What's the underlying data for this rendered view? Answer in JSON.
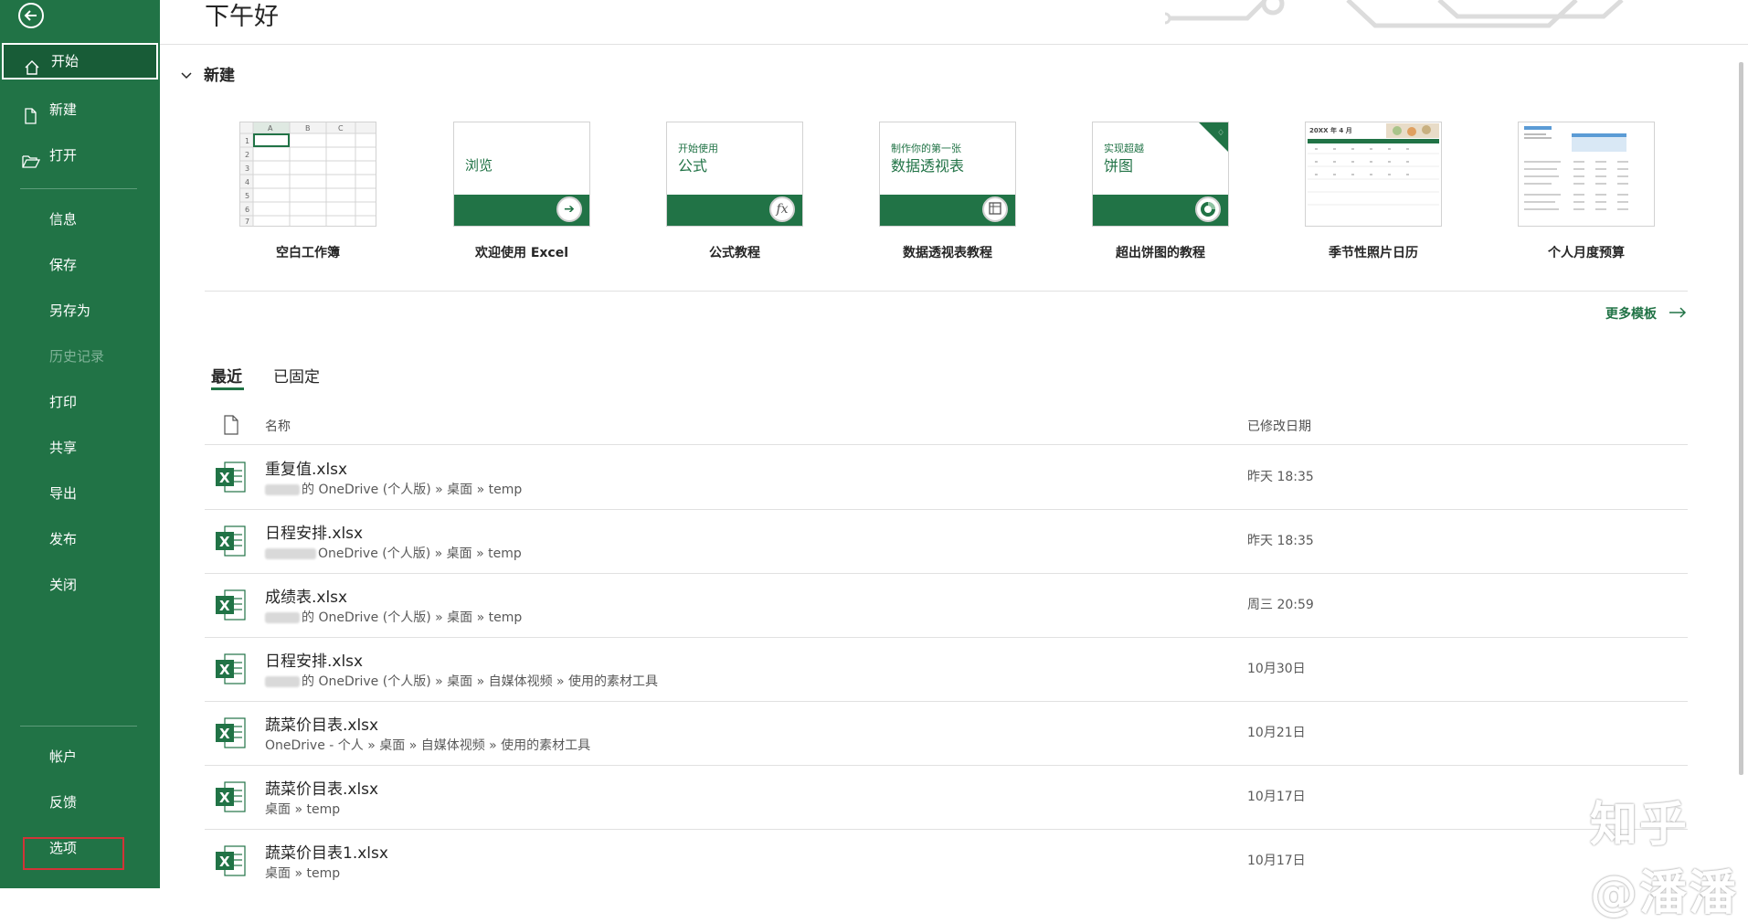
{
  "header": {
    "greeting": "下午好"
  },
  "sidebar": {
    "items": [
      {
        "label": "开始",
        "icon": "home-icon"
      },
      {
        "label": "新建",
        "icon": "new-document-icon"
      },
      {
        "label": "打开",
        "icon": "folder-open-icon"
      },
      {
        "label": "信息"
      },
      {
        "label": "保存"
      },
      {
        "label": "另存为"
      },
      {
        "label": "历史记录"
      },
      {
        "label": "打印"
      },
      {
        "label": "共享"
      },
      {
        "label": "导出"
      },
      {
        "label": "发布"
      },
      {
        "label": "关闭"
      }
    ],
    "bottom_items": [
      {
        "label": "帐户"
      },
      {
        "label": "反馈"
      },
      {
        "label": "选项"
      }
    ]
  },
  "new_section": {
    "title": "新建",
    "templates": [
      {
        "caption": "空白工作簿"
      },
      {
        "caption": "欢迎使用 Excel",
        "thumb_text": "浏览"
      },
      {
        "caption": "公式教程",
        "thumb_small": "开始使用",
        "thumb_big": "公式"
      },
      {
        "caption": "数据透视表教程",
        "thumb_small": "制作你的第一张",
        "thumb_big": "数据透视表"
      },
      {
        "caption": "超出饼图的教程",
        "thumb_small": "实现超越",
        "thumb_big": "饼图"
      },
      {
        "caption": "季节性照片日历",
        "thumb_text": "20XX 年 4 月"
      },
      {
        "caption": "个人月度预算"
      }
    ],
    "more_templates": "更多模板"
  },
  "tabs": [
    {
      "label": "最近"
    },
    {
      "label": "已固定"
    }
  ],
  "file_list": {
    "col_name": "名称",
    "col_date": "已修改日期",
    "rows": [
      {
        "name": "重复值.xlsx",
        "path": "的 OneDrive (个人版) » 桌面 » temp",
        "date": "昨天 18:35"
      },
      {
        "name": "日程安排.xlsx",
        "path": "OneDrive (个人版) » 桌面 » temp",
        "date": "昨天 18:35"
      },
      {
        "name": "成绩表.xlsx",
        "path": "的 OneDrive (个人版) » 桌面 » temp",
        "date": "周三 20:59"
      },
      {
        "name": "日程安排.xlsx",
        "path": "的 OneDrive (个人版) » 桌面 » 自媒体视频 » 使用的素材工具",
        "date": "10月30日"
      },
      {
        "name": "蔬菜价目表.xlsx",
        "path": "OneDrive - 个人 » 桌面 » 自媒体视频 » 使用的素材工具",
        "date": "10月21日"
      },
      {
        "name": "蔬菜价目表.xlsx",
        "path": "桌面 » temp",
        "date": "10月17日"
      },
      {
        "name": "蔬菜价目表1.xlsx",
        "path": "桌面 » temp",
        "date": "10月17日"
      }
    ]
  },
  "watermark": "知乎 @潘潘",
  "colors": {
    "brand_green": "#217346",
    "active_green": "#185c37",
    "highlight_red": "#d13438"
  }
}
